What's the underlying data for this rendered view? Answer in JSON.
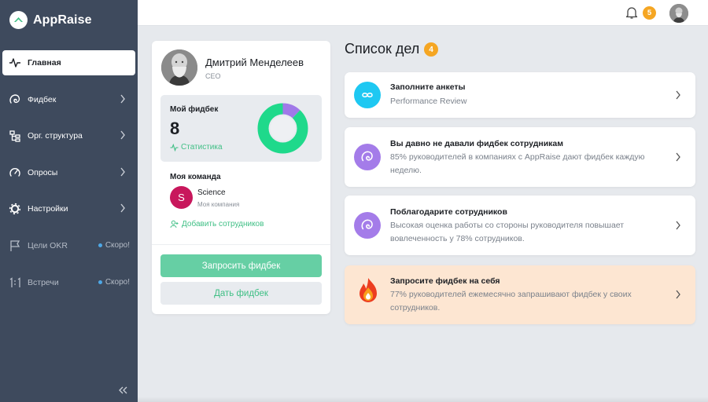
{
  "app": {
    "name": "AppRaise",
    "brand_color": "#3e4a5d",
    "accent_color": "#3fbf85"
  },
  "sidebar": {
    "items": [
      {
        "label": "Главная",
        "icon": "pulse-icon",
        "active": true
      },
      {
        "label": "Фидбек",
        "icon": "feedback-icon"
      },
      {
        "label": "Орг. структура",
        "icon": "org-structure-icon"
      },
      {
        "label": "Опросы",
        "icon": "gauge-icon"
      },
      {
        "label": "Настройки",
        "icon": "gear-icon"
      },
      {
        "label": "Цели OKR",
        "icon": "flag-icon",
        "soon": "Скоро!"
      },
      {
        "label": "Встречи",
        "icon": "one-on-one-icon",
        "soon": "Скоро!"
      }
    ],
    "collapse_icon": "double-chevron-left-icon"
  },
  "topbar": {
    "notifications_count": "5",
    "bell_icon": "bell-icon"
  },
  "profile": {
    "name": "Дмитрий Менделеев",
    "role": "CEO",
    "feedback_title": "Мой фидбек",
    "feedback_count": "8",
    "stats_link": "Статистика",
    "donut": {
      "green_fraction": 0.88,
      "purple_fraction": 0.12,
      "green_color": "#1fd98b",
      "purple_color": "#a079e8"
    },
    "team_title": "Моя команда",
    "team": {
      "initial": "S",
      "name": "Science",
      "sub": "Моя компания",
      "color": "#c8175c"
    },
    "add_staff": "Добавить сотрудников",
    "request_button": "Запросить фидбек",
    "give_button": "Дать фидбек"
  },
  "todo": {
    "title": "Список дел",
    "count": "4",
    "items": [
      {
        "heading": "Заполните анкеты",
        "desc": "Performance Review",
        "icon": "performance-review-icon",
        "icon_color": "#1ec8f2"
      },
      {
        "heading": "Вы давно не давали фидбек сотрудникам",
        "desc": "85% руководителей в компаниях с AppRaise дают фидбек каждую неделю.",
        "icon": "feedback-bubble-icon",
        "icon_color": "#a47ce9"
      },
      {
        "heading": "Поблагодарите сотрудников",
        "desc": "Высокая оценка работы со стороны руководителя повышает вовлеченность у 78% сотрудников.",
        "icon": "feedback-bubble-icon",
        "icon_color": "#a47ce9"
      },
      {
        "heading": "Запросите фидбек на себя",
        "desc": "77% руководителей ежемесячно запрашивают фидбек у своих сотрудников.",
        "icon": "fire-icon",
        "icon_color": "#f04a2a",
        "highlight": true
      }
    ]
  }
}
